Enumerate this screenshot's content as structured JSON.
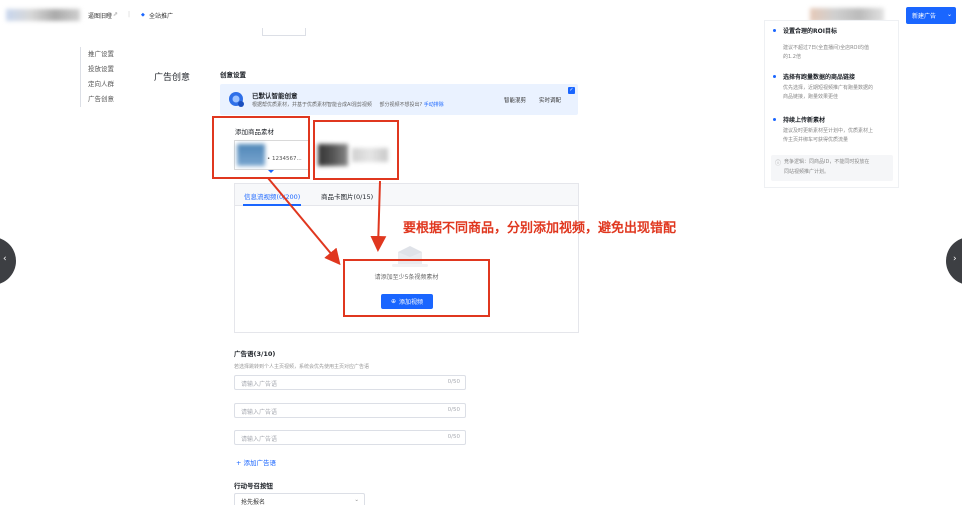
{
  "topbar": {
    "crumb_plan": "逼图旧瞪",
    "crumb_product": "全站推广",
    "new_ad_button": "新建广告"
  },
  "leftnav": {
    "items": [
      "推广设置",
      "投放设置",
      "定向人群",
      "广告创意"
    ]
  },
  "section": {
    "title": "广告创意",
    "subtitle": "创意设置"
  },
  "smart_banner": {
    "title": "已默认智能创意",
    "desc": "根据帮优质素材，并基于优质素材智能合成AI混剪视频",
    "desc_question": "部分视频不想投出?",
    "desc_link": "手动排除",
    "btn_preview": "智能混剪",
    "btn_custom": "实时调配"
  },
  "product": {
    "label": "添加商品素材",
    "card1_id": "• 1234567..."
  },
  "tabs": {
    "video": "信息流视频(0/200)",
    "image": "商品卡图片(0/15)"
  },
  "empty_state": {
    "text": "请添加至少5条视频素材",
    "button": "添加视频"
  },
  "annotation": "要根据不同商品，分别添加视频，避免出现错配",
  "ad_copy": {
    "title": "广告语(3/10)",
    "hint": "若选择跳转到个人主页视频，系统会优先使用主页对应广告语",
    "placeholder": "请输入广告语",
    "counter": "0/50",
    "add_link": "+ 添加广告语"
  },
  "cta": {
    "title": "行动号召按钮",
    "value": "抢先报名"
  },
  "right_panel": {
    "tips": [
      {
        "title": "设置合理的ROI目标",
        "desc": [
          "建议不超过7日(全直播间)全店ROI均值",
          "的1.2倍"
        ]
      },
      {
        "title": "选择有跑量数据的商品链接",
        "desc": [
          "优先选择，近期短视频推广有跑量数据的",
          "商品链接，跑量效果更佳"
        ]
      },
      {
        "title": "持续上传新素材",
        "desc": [
          "建议及时更新素材至计划中，优质素材上",
          "传主页并绑车可获得优质流量"
        ]
      }
    ],
    "footnote": [
      "竞争逻辑：同商品ID，不能同时投放在",
      "同站视频推广计划。"
    ]
  },
  "colors": {
    "accent": "#1a66ff",
    "annotation_red": "#e0371f"
  }
}
